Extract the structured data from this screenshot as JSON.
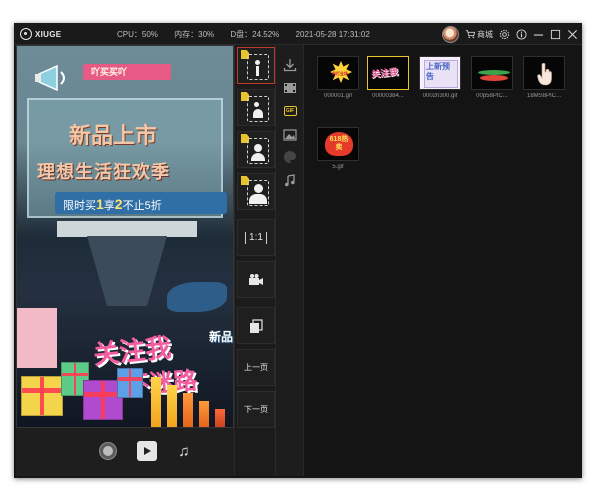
{
  "titlebar": {
    "app_name": "XIUGE",
    "cpu": "CPU：50%",
    "memory": "内存：30%",
    "disk": "D盘：24.52%",
    "datetime": "2021-05-28 17:31:02",
    "shop_label": "商城"
  },
  "preview": {
    "tag_text": "吖买买吖",
    "line1": "新品上市",
    "line2": "理想生活狂欢季",
    "line3_prefix": "限时买",
    "line3_n1": "1",
    "line3_mid": "享",
    "line3_n2": "2",
    "line3_suffix": "不止5折",
    "slogan1": "关注我",
    "slogan2": "不迷路",
    "side_text": "新品"
  },
  "tools": {
    "ratio_label": "1:1",
    "prev_page": "上一页",
    "next_page": "下一页"
  },
  "gallery": {
    "items": [
      {
        "label": "000001.gif",
        "thumb_text": "吊打全场",
        "selected": false
      },
      {
        "label": "00000384...",
        "thumb_text": "关注我",
        "selected": true
      },
      {
        "label": "0002h300.gif",
        "thumb_text": "上新预告",
        "selected": false
      },
      {
        "label": "00p58PIC...",
        "thumb_text": "",
        "selected": false
      },
      {
        "label": "18MS8PIC...",
        "thumb_text": "",
        "selected": false
      },
      {
        "label": "5.gif",
        "thumb_text": "618热卖",
        "selected": false
      }
    ]
  },
  "colors": {
    "accent_yellow": "#e8c42a",
    "active_red": "#c0392b",
    "window_bg": "#161616"
  }
}
